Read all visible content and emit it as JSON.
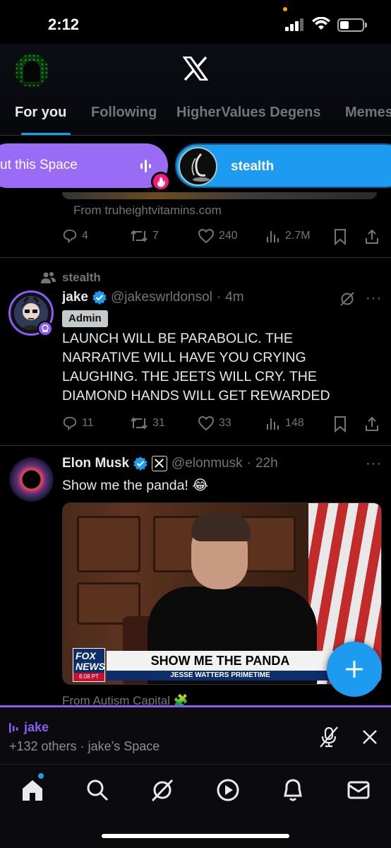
{
  "status_bar": {
    "time": "2:12"
  },
  "header": {
    "tabs": [
      {
        "label": "For you",
        "active": true
      },
      {
        "label": "Following",
        "active": false
      },
      {
        "label": "HigherValues Degens",
        "active": false
      },
      {
        "label": "Memes",
        "active": false
      }
    ]
  },
  "spaces_bar": {
    "current_space_label": "ut this Space",
    "other_space_label": "stealth"
  },
  "tweets": [
    {
      "source": "From truheightvitamins.com",
      "replies": "4",
      "reposts": "7",
      "likes": "240",
      "views": "2.7M"
    },
    {
      "context": "stealth",
      "name": "jake",
      "handle": "@jakeswrldonsol",
      "time": "4m",
      "role_badge": "Admin",
      "text": "LAUNCH WILL BE PARABOLIC. THE NARRATIVE WILL HAVE YOU CRYING LAUGHING. THE JEETS WILL CRY. THE DIAMOND HANDS WILL GET REWARDED",
      "replies": "11",
      "reposts": "31",
      "likes": "33",
      "views": "148"
    },
    {
      "name": "Elon Musk",
      "handle": "@elonmusk",
      "time": "22h",
      "text": "Show me the panda! 😂",
      "media_chyron": {
        "network_line1": "FOX",
        "network_line2": "NEWS",
        "clock": "6:08 PT",
        "headline": "SHOW ME THE PANDA",
        "subline": "JESSE WATTERS PRIMETIME"
      },
      "source": "From Autism Capital 🧩"
    }
  ],
  "space_player": {
    "host": "jake",
    "listeners": "+132 others · jake’s Space"
  },
  "colors": {
    "accent": "#1d9bf0",
    "spaces_purple": "#8b5cf6",
    "muted_text": "#71767b"
  },
  "icons": {
    "nav": [
      "home-icon",
      "search-icon",
      "grok-icon",
      "play-icon",
      "bell-icon",
      "mail-icon"
    ]
  }
}
